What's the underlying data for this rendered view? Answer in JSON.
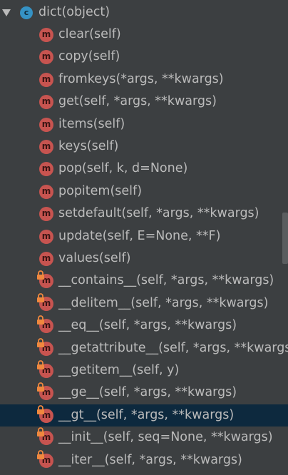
{
  "tree": {
    "root": {
      "label": "dict(object)",
      "icon": "class-icon",
      "icon_letter": "c",
      "expanded": true
    },
    "method_icon_letter": "m",
    "items": [
      {
        "label": "clear(self)",
        "icon": "method-icon",
        "private": false
      },
      {
        "label": "copy(self)",
        "icon": "method-icon",
        "private": false
      },
      {
        "label": "fromkeys(*args, **kwargs)",
        "icon": "method-icon",
        "private": false
      },
      {
        "label": "get(self, *args, **kwargs)",
        "icon": "method-icon",
        "private": false
      },
      {
        "label": "items(self)",
        "icon": "method-icon",
        "private": false
      },
      {
        "label": "keys(self)",
        "icon": "method-icon",
        "private": false
      },
      {
        "label": "pop(self, k, d=None)",
        "icon": "method-icon",
        "private": false
      },
      {
        "label": "popitem(self)",
        "icon": "method-icon",
        "private": false
      },
      {
        "label": "setdefault(self, *args, **kwargs)",
        "icon": "method-icon",
        "private": false
      },
      {
        "label": "update(self, E=None, **F)",
        "icon": "method-icon",
        "private": false
      },
      {
        "label": "values(self)",
        "icon": "method-icon",
        "private": false
      },
      {
        "label": "__contains__(self, *args, **kwargs)",
        "icon": "method-icon",
        "private": true
      },
      {
        "label": "__delitem__(self, *args, **kwargs)",
        "icon": "method-icon",
        "private": true
      },
      {
        "label": "__eq__(self, *args, **kwargs)",
        "icon": "method-icon",
        "private": true
      },
      {
        "label": "__getattribute__(self, *args, **kwargs)",
        "icon": "method-icon",
        "private": true
      },
      {
        "label": "__getitem__(self, y)",
        "icon": "method-icon",
        "private": true
      },
      {
        "label": "__ge__(self, *args, **kwargs)",
        "icon": "method-icon",
        "private": true
      },
      {
        "label": "__gt__(self, *args, **kwargs)",
        "icon": "method-icon",
        "private": true,
        "selected": true
      },
      {
        "label": "__init__(self, seq=None, **kwargs)",
        "icon": "method-icon",
        "private": true
      },
      {
        "label": "__iter__(self, *args, **kwargs)",
        "icon": "method-icon",
        "private": true
      }
    ]
  },
  "colors": {
    "background": "#3c3f41",
    "text": "#bbbbbb",
    "selected_row": "#0d293e",
    "method_icon": "#c75450",
    "class_icon": "#3592c4",
    "lock_icon": "#f0883e"
  }
}
